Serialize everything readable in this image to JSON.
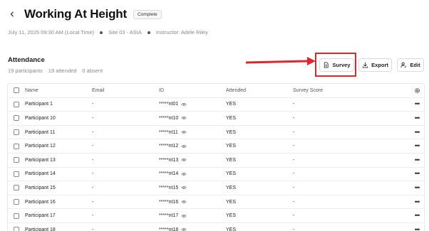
{
  "header": {
    "title": "Working At Height",
    "status_badge": "Complete"
  },
  "meta": {
    "datetime": "July 11, 2025 09:30 AM (Local Time)",
    "site": "Site 03 - ASIA",
    "instructor": "Instructor: Adele Riley"
  },
  "attendance": {
    "title": "Attendance",
    "participants": "19 participants",
    "attended": "19 attended",
    "absent": "0 absent"
  },
  "actions": {
    "survey_label": "Survey",
    "export_label": "Export",
    "edit_label": "Edit"
  },
  "annotation": {
    "highlight_color": "#e3242b"
  },
  "table": {
    "columns": {
      "name": "Name",
      "email": "Email",
      "id": "ID",
      "attended": "Attended",
      "survey_score": "Survey Score"
    },
    "rows": [
      {
        "name": "Participant 1",
        "email": "-",
        "id": "*****nt01",
        "attended": "YES",
        "score": "-"
      },
      {
        "name": "Participant 10",
        "email": "-",
        "id": "*****nt10",
        "attended": "YES",
        "score": "-"
      },
      {
        "name": "Participant 11",
        "email": "-",
        "id": "*****nt11",
        "attended": "YES",
        "score": "-"
      },
      {
        "name": "Participant 12",
        "email": "-",
        "id": "*****nt12",
        "attended": "YES",
        "score": "-"
      },
      {
        "name": "Participant 13",
        "email": "-",
        "id": "*****nt13",
        "attended": "YES",
        "score": "-"
      },
      {
        "name": "Participant 14",
        "email": "-",
        "id": "*****nt14",
        "attended": "YES",
        "score": "-"
      },
      {
        "name": "Participant 15",
        "email": "-",
        "id": "*****nt15",
        "attended": "YES",
        "score": "-"
      },
      {
        "name": "Participant 16",
        "email": "-",
        "id": "*****nt16",
        "attended": "YES",
        "score": "-"
      },
      {
        "name": "Participant 17",
        "email": "-",
        "id": "*****nt17",
        "attended": "YES",
        "score": "-"
      },
      {
        "name": "Participant 18",
        "email": "-",
        "id": "*****nt18",
        "attended": "YES",
        "score": "-"
      }
    ]
  }
}
